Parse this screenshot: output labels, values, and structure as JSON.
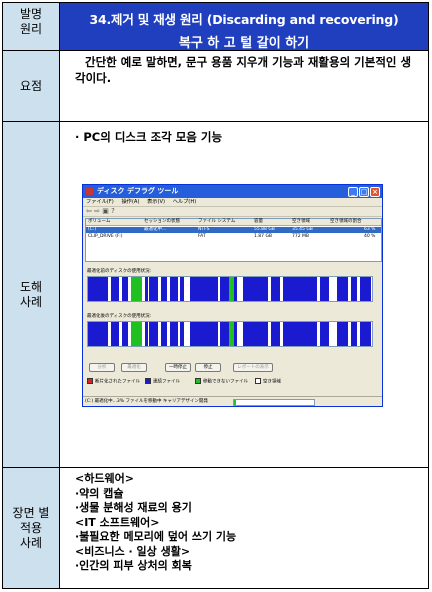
{
  "row1": {
    "label": "발명\n원리",
    "title_line1": "34.제거 및 재생 원리 (Discarding and recovering)",
    "title_line2": "복구 하 고 털 갈이 하기"
  },
  "row2": {
    "label": "요점",
    "text": "간단한 예로 말하면, 문구 용품 지우개 기능과 재활용의 기본적인 생각이다."
  },
  "row3": {
    "label": "도해\n사례",
    "bullet": "· PC의 디스크 조각 모음 기능"
  },
  "row4": {
    "label": "장면 별\n적용\n사례",
    "items": [
      "<하드웨어>",
      "·약의 캡슐",
      "·생물 분해성 재료의 용기",
      "<IT 소프트웨어>",
      "·불필요한 메모리에 덮어 쓰기 기능",
      "<비즈니스 · 일상 생활>",
      "·인간의 피부 상처의 회복"
    ]
  },
  "screenshot": {
    "title": "ディスク デフラグ ツール",
    "menus": [
      "ファイル(F)",
      "操作(A)",
      "表示(V)",
      "ヘルプ(H)"
    ],
    "columns": [
      "ボリューム",
      "セッションの状態",
      "ファイル システム",
      "容量",
      "空き領域",
      "空き領域の割合"
    ],
    "volumes": [
      [
        "(C:)",
        "最適化中...",
        "NTFS",
        "55.88 GB",
        "35.45 GB",
        "63 %"
      ],
      [
        "CLIP_DRIVE (F:)",
        "",
        "FAT",
        "1.87 GB",
        "772 MB",
        "40 %"
      ]
    ],
    "before_label": "最適化前のディスクの使用状況:",
    "after_label": "最適化後のディスクの使用状況:",
    "buttons": [
      "分析",
      "最適化",
      "一時停止",
      "停止",
      "レポートの表示"
    ],
    "legend": [
      {
        "label": "断片化されたファイル",
        "color": "#e02020"
      },
      {
        "label": "連続ファイル",
        "color": "#1a1ad0"
      },
      {
        "label": "移動できないファイル",
        "color": "#20c020"
      },
      {
        "label": "空き領域",
        "color": "#ffffff"
      }
    ],
    "status": "(C:) 最適化中...3% ファイルを移動中 キャリアデザイン開発",
    "progress": 0.03,
    "colors": {
      "titlebar": "#245edb",
      "used": "#1a1ad0",
      "unmovable": "#20c020",
      "fragmented": "#e02020"
    }
  }
}
